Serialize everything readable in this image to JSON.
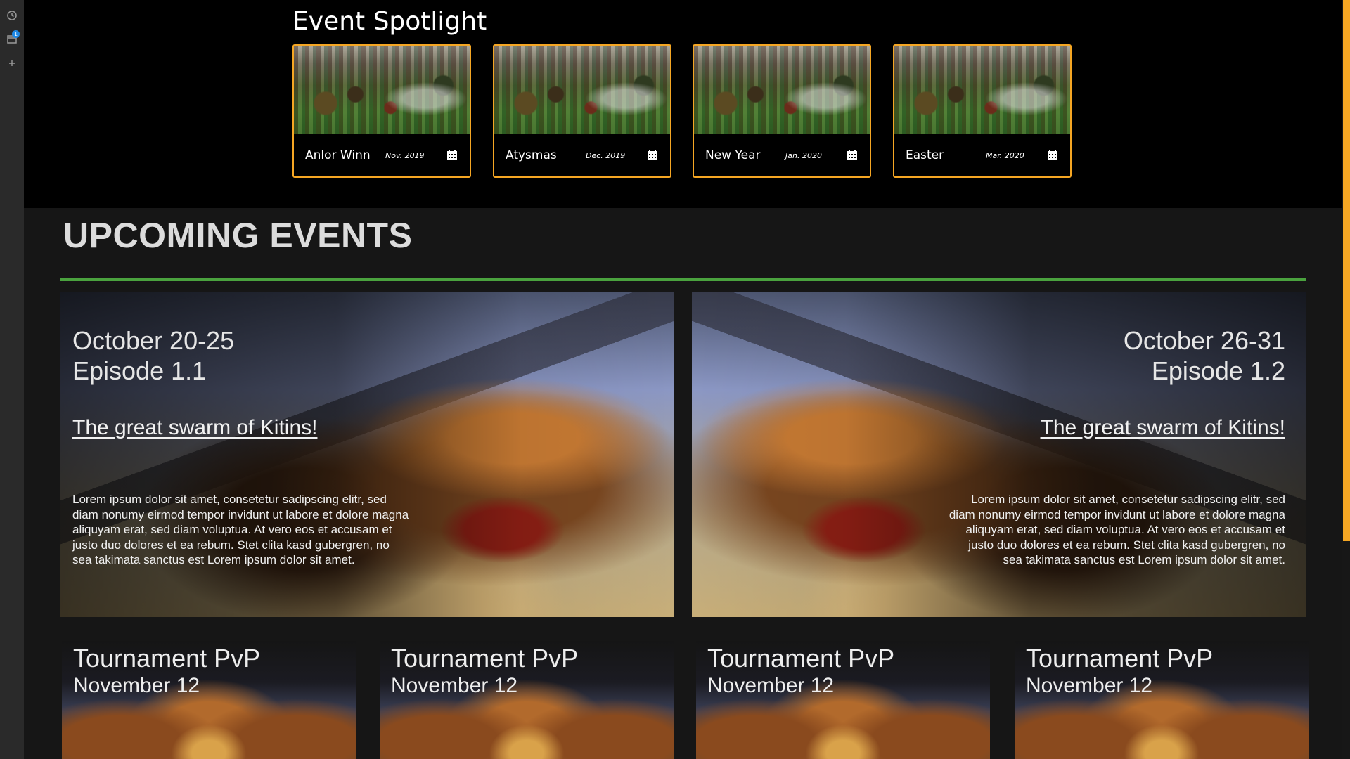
{
  "rail": {
    "items": [
      {
        "name": "history",
        "icon": "clock-icon"
      },
      {
        "name": "tabs",
        "icon": "window-icon",
        "badge": "1"
      },
      {
        "name": "add",
        "icon": "plus-icon"
      }
    ]
  },
  "spotlight": {
    "title": "Event Spotlight",
    "accent_color": "#f5a623",
    "cards": [
      {
        "name": "Anlor Winn",
        "date": "Nov. 2019",
        "icon": "calendar-icon"
      },
      {
        "name": "Atysmas",
        "date": "Dec. 2019",
        "icon": "calendar-icon"
      },
      {
        "name": "New Year",
        "date": "Jan. 2020",
        "icon": "calendar-icon"
      },
      {
        "name": "Easter",
        "date": "Mar. 2020",
        "icon": "calendar-icon"
      }
    ]
  },
  "upcoming": {
    "heading": "UPCOMING EVENTS",
    "rule_color": "#4aa23e",
    "episodes": [
      {
        "date": "October 20-25",
        "episode": "Episode 1.1",
        "link": "The great swarm of Kitins!",
        "description": "Lorem ipsum dolor sit amet, consetetur sadipscing elitr, sed diam nonumy eirmod tempor invidunt ut labore et dolore magna aliquyam erat, sed diam voluptua. At vero eos et accusam et justo duo dolores et ea rebum. Stet clita kasd gubergren, no sea takimata sanctus est Lorem ipsum dolor sit amet."
      },
      {
        "date": "October 26-31",
        "episode": "Episode 1.2",
        "link": "The great swarm of Kitins!",
        "description": "Lorem ipsum dolor sit amet, consetetur sadipscing elitr, sed diam nonumy eirmod tempor invidunt ut labore et dolore magna aliquyam erat, sed diam voluptua. At vero eos et accusam et justo duo dolores et ea rebum. Stet clita kasd gubergren, no sea takimata sanctus est Lorem ipsum dolor sit amet."
      }
    ],
    "tournaments": [
      {
        "title": "Tournament PvP",
        "date": "November 12"
      },
      {
        "title": "Tournament PvP",
        "date": "November 12"
      },
      {
        "title": "Tournament PvP",
        "date": "November 12"
      },
      {
        "title": "Tournament PvP",
        "date": "November 12"
      }
    ]
  }
}
